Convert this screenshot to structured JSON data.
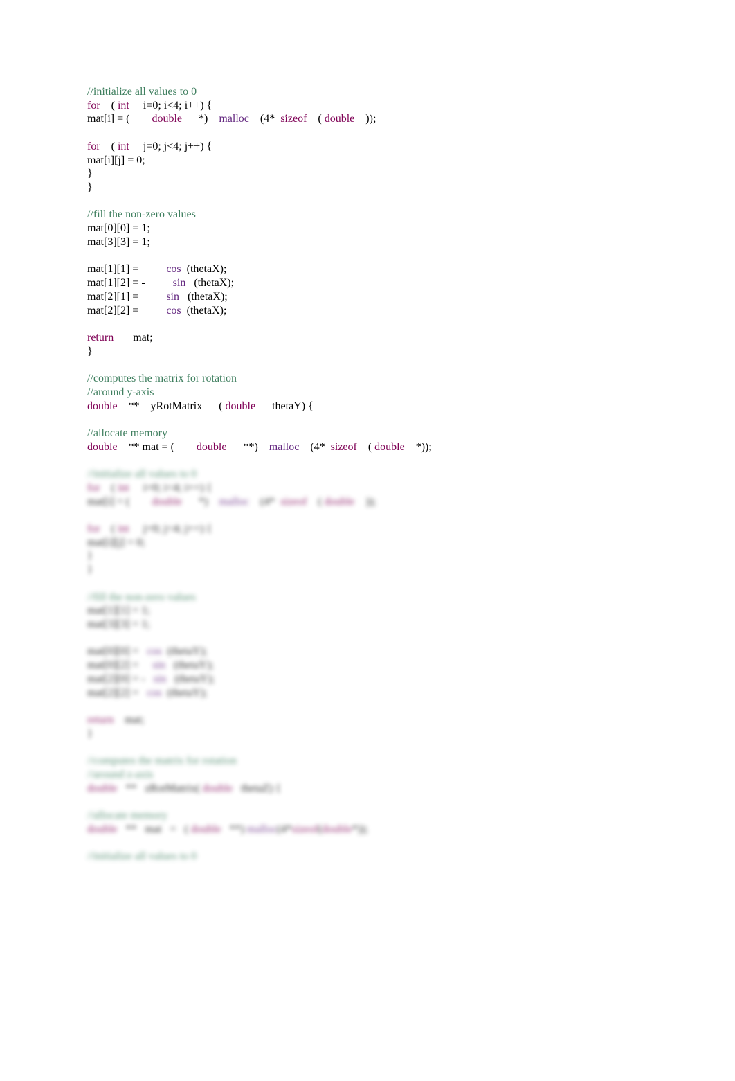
{
  "colors": {
    "comment": "#3f7f5f",
    "keyword": "#7f0055",
    "function": "#642880",
    "text": "#000000"
  },
  "visible_code": [
    [
      [
        "comment",
        "//initialize all values to 0"
      ]
    ],
    [
      [
        "keyword",
        "for"
      ],
      [
        "plain",
        "    ( "
      ],
      [
        "keyword",
        "int"
      ],
      [
        "plain",
        "     i=0; i<4; i++) {"
      ]
    ],
    [
      [
        "plain",
        "mat[i] = (        "
      ],
      [
        "keyword",
        "double"
      ],
      [
        "plain",
        "      *)    "
      ],
      [
        "func",
        "malloc"
      ],
      [
        "plain",
        "    (4*  "
      ],
      [
        "keyword",
        "sizeof"
      ],
      [
        "plain",
        "    ( "
      ],
      [
        "keyword",
        "double"
      ],
      [
        "plain",
        "    ));"
      ]
    ],
    [],
    [
      [
        "keyword",
        "for"
      ],
      [
        "plain",
        "    ( "
      ],
      [
        "keyword",
        "int"
      ],
      [
        "plain",
        "     j=0; j<4; j++) {"
      ]
    ],
    [
      [
        "plain",
        "mat[i][j] = 0;"
      ]
    ],
    [
      [
        "plain",
        "}"
      ]
    ],
    [
      [
        "plain",
        "}"
      ]
    ],
    [],
    [
      [
        "comment",
        "//fill the non-zero values"
      ]
    ],
    [
      [
        "plain",
        "mat[0][0] = 1;"
      ]
    ],
    [
      [
        "plain",
        "mat[3][3] = 1;"
      ]
    ],
    [],
    [
      [
        "plain",
        "mat[1][1] =          "
      ],
      [
        "func",
        "cos"
      ],
      [
        "plain",
        "  (thetaX);"
      ]
    ],
    [
      [
        "plain",
        "mat[1][2] = -          "
      ],
      [
        "func",
        "sin"
      ],
      [
        "plain",
        "   (thetaX);"
      ]
    ],
    [
      [
        "plain",
        "mat[2][1] =          "
      ],
      [
        "func",
        "sin"
      ],
      [
        "plain",
        "   (thetaX);"
      ]
    ],
    [
      [
        "plain",
        "mat[2][2] =          "
      ],
      [
        "func",
        "cos"
      ],
      [
        "plain",
        "  (thetaX);"
      ]
    ],
    [],
    [
      [
        "keyword",
        "return"
      ],
      [
        "plain",
        "       mat;"
      ]
    ],
    [
      [
        "plain",
        "}"
      ]
    ],
    [],
    [
      [
        "comment",
        "//computes the matrix for rotation"
      ]
    ],
    [
      [
        "comment",
        "//around y-axis"
      ]
    ],
    [
      [
        "keyword",
        "double"
      ],
      [
        "plain",
        "    **    yRotMatrix      ( "
      ],
      [
        "keyword",
        "double"
      ],
      [
        "plain",
        "      thetaY) {"
      ]
    ],
    [],
    [
      [
        "comment",
        "//allocate memory"
      ]
    ],
    [
      [
        "keyword",
        "double"
      ],
      [
        "plain",
        "    ** mat = (        "
      ],
      [
        "keyword",
        "double"
      ],
      [
        "plain",
        "      **)    "
      ],
      [
        "func",
        "malloc"
      ],
      [
        "plain",
        "    (4*  "
      ],
      [
        "keyword",
        "sizeof"
      ],
      [
        "plain",
        "    ( "
      ],
      [
        "keyword",
        "double"
      ],
      [
        "plain",
        "    *));"
      ]
    ]
  ],
  "blurred_code": [
    [],
    [
      [
        "comment",
        "//initialize all values to 0"
      ]
    ],
    [
      [
        "keyword",
        "for"
      ],
      [
        "plain",
        "    ( "
      ],
      [
        "keyword",
        "int"
      ],
      [
        "plain",
        "     i=0; i<4; i++) {"
      ]
    ],
    [
      [
        "plain",
        "mat[i] = (        "
      ],
      [
        "keyword",
        "double"
      ],
      [
        "plain",
        "      *)    "
      ],
      [
        "func",
        "malloc"
      ],
      [
        "plain",
        "    (4*  "
      ],
      [
        "keyword",
        "sizeof"
      ],
      [
        "plain",
        "    ( "
      ],
      [
        "keyword",
        "double"
      ],
      [
        "plain",
        "    ));"
      ]
    ],
    [],
    [
      [
        "keyword",
        "for"
      ],
      [
        "plain",
        "    ( "
      ],
      [
        "keyword",
        "int"
      ],
      [
        "plain",
        "     j=0; j<4; j++) {"
      ]
    ],
    [
      [
        "plain",
        "mat[i][j] = 0;"
      ]
    ],
    [
      [
        "plain",
        "}"
      ]
    ],
    [
      [
        "plain",
        "}"
      ]
    ],
    [],
    [
      [
        "comment",
        "//fill the non-zero values"
      ]
    ],
    [
      [
        "plain",
        "mat[1][1] = 1;"
      ]
    ],
    [
      [
        "plain",
        "mat[3][3] = 1;"
      ]
    ],
    [],
    [
      [
        "plain",
        "mat[0][0] =   "
      ],
      [
        "func",
        "cos"
      ],
      [
        "plain",
        "  (thetaY);"
      ]
    ],
    [
      [
        "plain",
        "mat[0][2] =     "
      ],
      [
        "func",
        "sin"
      ],
      [
        "plain",
        "   (thetaY);"
      ]
    ],
    [
      [
        "plain",
        "mat[2][0] = -   "
      ],
      [
        "func",
        "sin"
      ],
      [
        "plain",
        "   (thetaY);"
      ]
    ],
    [
      [
        "plain",
        "mat[2][2] =   "
      ],
      [
        "func",
        "cos"
      ],
      [
        "plain",
        "  (thetaY);"
      ]
    ],
    [],
    [
      [
        "keyword",
        "return"
      ],
      [
        "plain",
        "    mat;"
      ]
    ],
    [
      [
        "plain",
        "}"
      ]
    ],
    [],
    [
      [
        "comment",
        "//computes the matrix for rotation"
      ]
    ],
    [
      [
        "comment",
        "//around z-axis"
      ]
    ],
    [
      [
        "keyword",
        "double"
      ],
      [
        "plain",
        "   **   zRotMatrix( "
      ],
      [
        "keyword",
        "double"
      ],
      [
        "plain",
        "   thetaZ) {"
      ]
    ],
    [],
    [
      [
        "comment",
        "//allocate memory"
      ]
    ],
    [
      [
        "keyword",
        "double"
      ],
      [
        "plain",
        "   **   mat   =   ( "
      ],
      [
        "keyword",
        "double"
      ],
      [
        "plain",
        "   **) "
      ],
      [
        "func",
        "malloc"
      ],
      [
        "plain",
        "(4*"
      ],
      [
        "keyword",
        "sizeof"
      ],
      [
        "plain",
        "("
      ],
      [
        "keyword",
        "double"
      ],
      [
        "plain",
        "*));"
      ]
    ],
    [],
    [
      [
        "comment",
        "//initialize all values to 0"
      ]
    ]
  ]
}
